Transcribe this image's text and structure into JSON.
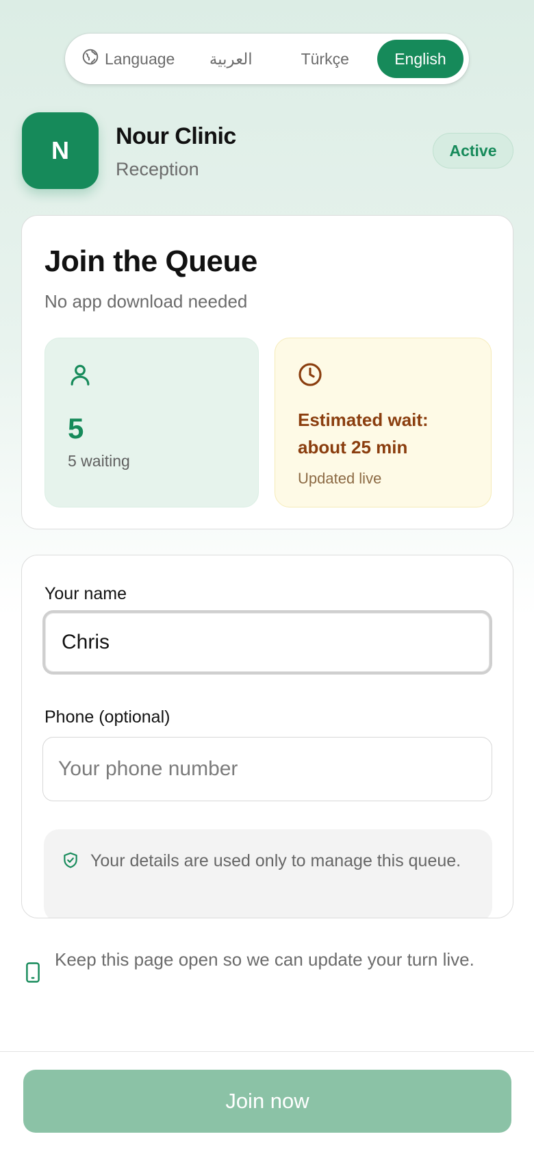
{
  "language_bar": {
    "label": "Language",
    "options": [
      {
        "label": "العربية",
        "selected": false
      },
      {
        "label": "Türkçe",
        "selected": false
      },
      {
        "label": "English",
        "selected": true
      }
    ]
  },
  "clinic": {
    "initial": "N",
    "name": "Nour Clinic",
    "department": "Reception",
    "status": "Active"
  },
  "queue": {
    "title": "Join the Queue",
    "subtitle": "No app download needed",
    "waiting_count": "5",
    "waiting_caption": "5 waiting",
    "estimate_line1": "Estimated wait:",
    "estimate_line2": "about 25 min",
    "estimate_caption": "Updated live"
  },
  "form": {
    "name_label": "Your name",
    "name_value": "Chris",
    "phone_label": "Phone (optional)",
    "phone_placeholder": "Your phone number",
    "phone_value": "",
    "privacy_note": "Your details are used only to manage this queue."
  },
  "keep_open_note": "Keep this page open so we can update your turn live.",
  "join_button_label": "Join now",
  "colors": {
    "primary": "#168a5a",
    "primary_disabled": "#8bc2a6",
    "estimate_text": "#8a3d0e",
    "estimate_bg": "#fefae6",
    "waiting_bg": "#e6f3ec"
  },
  "icons": {
    "language": "globe-icon",
    "waiting": "person-icon",
    "estimate": "clock-icon",
    "privacy": "shield-check-icon",
    "keep_open": "phone-icon"
  }
}
